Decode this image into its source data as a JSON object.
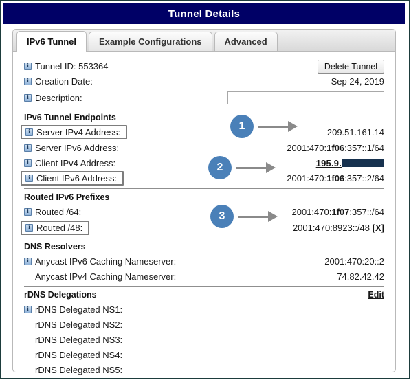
{
  "window": {
    "title": "Tunnel Details"
  },
  "tabs": [
    {
      "label": "IPv6 Tunnel",
      "active": true
    },
    {
      "label": "Example Configurations",
      "active": false
    },
    {
      "label": "Advanced",
      "active": false
    }
  ],
  "summary": {
    "tunnel_id_label": "Tunnel ID: 553364",
    "delete_button": "Delete Tunnel",
    "creation_date_label": "Creation Date:",
    "creation_date_value": "Sep 24, 2019",
    "description_label": "Description:",
    "description_value": "",
    "description_placeholder": ""
  },
  "endpoints": {
    "heading": "IPv6 Tunnel Endpoints",
    "server_ipv4_label": "Server IPv4 Address:",
    "server_ipv4_value": "209.51.161.14",
    "server_ipv6_label": "Server IPv6 Address:",
    "server_ipv6_value": "2001:470:1f06:357::1/64",
    "server_ipv6_value_pre": "2001:470:",
    "server_ipv6_value_bold": "1f06",
    "server_ipv6_value_post": ":357::1/64",
    "client_ipv4_label": "Client IPv4 Address:",
    "client_ipv4_value_visible": "195.9.",
    "client_ipv4_value_redacted": "[redacted]",
    "client_ipv6_label": "Client IPv6 Address:",
    "client_ipv6_value": "2001:470:1f06:357::2/64",
    "client_ipv6_value_pre": "2001:470:",
    "client_ipv6_value_bold": "1f06",
    "client_ipv6_value_post": ":357::2/64"
  },
  "prefixes": {
    "heading": "Routed IPv6 Prefixes",
    "routed64_label": "Routed /64:",
    "routed64_value_pre": "2001:470:",
    "routed64_value_bold": "1f07",
    "routed64_value_post": ":357::/64",
    "routed48_label": "Routed /48:",
    "routed48_value": "2001:470:8923::/48",
    "routed48_delete_open": "[",
    "routed48_delete_key": "X",
    "routed48_delete_close": "]"
  },
  "dns": {
    "heading": "DNS Resolvers",
    "anycast_v6_label": "Anycast IPv6 Caching Nameserver:",
    "anycast_v6_value": "2001:470:20::2",
    "anycast_v4_label": "Anycast IPv4 Caching Nameserver:",
    "anycast_v4_value": "74.82.42.42"
  },
  "rdns": {
    "heading": "rDNS Delegations",
    "edit_label": "Edit",
    "rows": [
      {
        "label": "rDNS Delegated NS1:",
        "value": "",
        "icon": true
      },
      {
        "label": "rDNS Delegated NS2:",
        "value": "",
        "icon": false
      },
      {
        "label": "rDNS Delegated NS3:",
        "value": "",
        "icon": false
      },
      {
        "label": "rDNS Delegated NS4:",
        "value": "",
        "icon": false
      },
      {
        "label": "rDNS Delegated NS5:",
        "value": "",
        "icon": false
      }
    ]
  },
  "callouts": [
    {
      "number": "1",
      "target": "server_ipv4_value"
    },
    {
      "number": "2",
      "target": "client_ipv6_value"
    },
    {
      "number": "3",
      "target": "routed48_value"
    }
  ],
  "colors": {
    "titlebar_bg": "#000066",
    "badge_blue": "#4a80b8",
    "arrow_gray": "#8a8a8a",
    "redaction": "#17324f",
    "frame_border": "#1d3c3c"
  }
}
